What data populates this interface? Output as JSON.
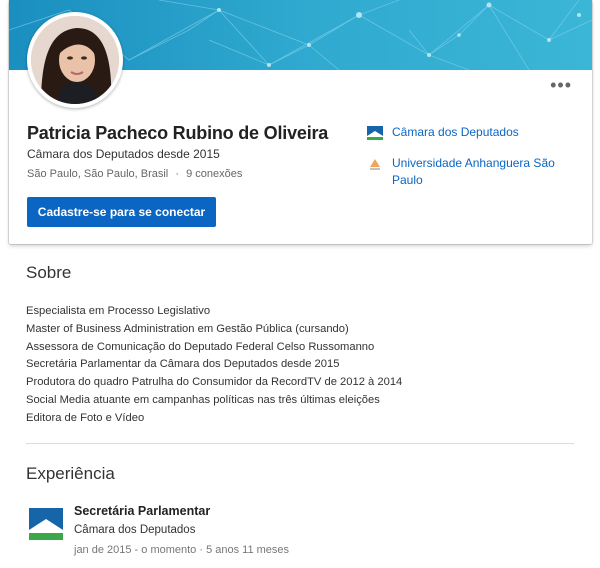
{
  "profile": {
    "name": "Patricia Pacheco Rubino de Oliveira",
    "headline": "Câmara dos Deputados desde 2015",
    "location": "São Paulo, São Paulo, Brasil",
    "separator": "·",
    "connections": "9 conexões",
    "connect_label": "Cadastre-se para se conectar",
    "more_label": "•••"
  },
  "organizations": [
    {
      "label": "Câmara dos Deputados",
      "icon": "camara-logo-icon"
    },
    {
      "label": "Universidade Anhanguera São Paulo",
      "icon": "university-logo-icon"
    }
  ],
  "about": {
    "title": "Sobre",
    "lines": [
      "Especialista em Processo Legislativo",
      "Master of Business Administration em Gestão Pública (cursando)",
      "Assessora de Comunicação do Deputado Federal Celso Russomanno",
      "Secretária Parlamentar da Câmara dos Deputados desde 2015",
      "Produtora do quadro Patrulha do Consumidor da RecordTV de 2012 à 2014",
      "Social Media atuante em campanhas políticas nas três últimas eleições",
      "Editora de Foto e Vídeo"
    ]
  },
  "experience": {
    "title": "Experiência",
    "items": [
      {
        "title": "Secretária Parlamentar",
        "company": "Câmara dos Deputados",
        "dates": "jan de 2015 - o momento · 5 anos 11 meses"
      }
    ]
  },
  "colors": {
    "accent": "#0a66c2",
    "banner": "#2aa0c9",
    "logo_green": "#3aa84a"
  }
}
